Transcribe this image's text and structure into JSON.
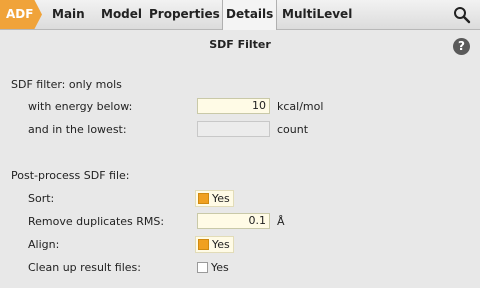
{
  "tabs": {
    "adf": "ADF",
    "main": "Main",
    "model": "Model",
    "properties": "Properties",
    "details": "Details",
    "multilevel": "MultiLevel"
  },
  "panel": {
    "title": "SDF Filter",
    "help": "?"
  },
  "sdf_filter": {
    "heading": "SDF filter: only mols",
    "energy_label": "with energy below:",
    "energy_value": "10",
    "energy_unit": "kcal/mol",
    "lowest_label": "and in the lowest:",
    "lowest_value": "",
    "lowest_unit": "count"
  },
  "post_process": {
    "heading": "Post-process SDF file:",
    "sort_label": "Sort:",
    "sort_option": "Yes",
    "sort_checked": true,
    "rms_label": "Remove duplicates RMS:",
    "rms_value": "0.1",
    "rms_unit": "Å",
    "align_label": "Align:",
    "align_option": "Yes",
    "align_checked": true,
    "cleanup_label": "Clean up result files:",
    "cleanup_option": "Yes",
    "cleanup_checked": false
  },
  "colors": {
    "accent": "#f0a33a",
    "field_bg": "#fffbe6",
    "panel_bg": "#e8e8e8"
  }
}
